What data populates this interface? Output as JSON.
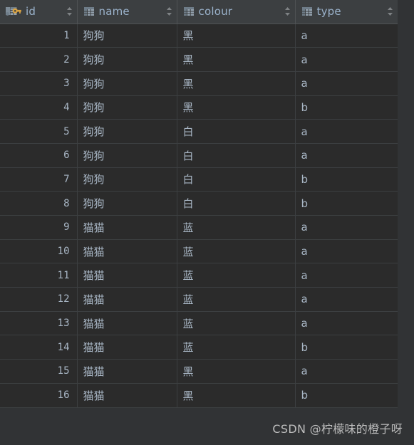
{
  "colors": {
    "header_bg": "#3c3f41",
    "row_bg": "#2b2b2b",
    "page_bg": "#313335",
    "grid_line": "#3c3f41",
    "header_text": "#9bb3cc",
    "cell_text": "#a9b7c6",
    "key_icon": "#d9a343",
    "table_icon": "#93a1ad",
    "watermark_text": "#c8c8c8"
  },
  "table": {
    "columns": [
      {
        "label": "id",
        "icon": "primary-key-icon",
        "sort_icon": "sort-updown-icon",
        "align": "right"
      },
      {
        "label": "name",
        "icon": "table-column-icon",
        "sort_icon": "sort-updown-icon",
        "align": "left"
      },
      {
        "label": "colour",
        "icon": "table-column-icon",
        "sort_icon": "sort-updown-icon",
        "align": "left"
      },
      {
        "label": "type",
        "icon": "table-column-icon",
        "sort_icon": "sort-updown-icon",
        "align": "left"
      }
    ],
    "rows": [
      {
        "id": "1",
        "name": "狗狗",
        "colour": "黑",
        "type": "a"
      },
      {
        "id": "2",
        "name": "狗狗",
        "colour": "黑",
        "type": "a"
      },
      {
        "id": "3",
        "name": "狗狗",
        "colour": "黑",
        "type": "a"
      },
      {
        "id": "4",
        "name": "狗狗",
        "colour": "黑",
        "type": "b"
      },
      {
        "id": "5",
        "name": "狗狗",
        "colour": "白",
        "type": "a"
      },
      {
        "id": "6",
        "name": "狗狗",
        "colour": "白",
        "type": "a"
      },
      {
        "id": "7",
        "name": "狗狗",
        "colour": "白",
        "type": "b"
      },
      {
        "id": "8",
        "name": "狗狗",
        "colour": "白",
        "type": "b"
      },
      {
        "id": "9",
        "name": "猫猫",
        "colour": "蓝",
        "type": "a"
      },
      {
        "id": "10",
        "name": "猫猫",
        "colour": "蓝",
        "type": "a"
      },
      {
        "id": "11",
        "name": "猫猫",
        "colour": "蓝",
        "type": "a"
      },
      {
        "id": "12",
        "name": "猫猫",
        "colour": "蓝",
        "type": "a"
      },
      {
        "id": "13",
        "name": "猫猫",
        "colour": "蓝",
        "type": "a"
      },
      {
        "id": "14",
        "name": "猫猫",
        "colour": "蓝",
        "type": "b"
      },
      {
        "id": "15",
        "name": "猫猫",
        "colour": "黑",
        "type": "a"
      },
      {
        "id": "16",
        "name": "猫猫",
        "colour": "黑",
        "type": "b"
      }
    ]
  },
  "watermark": {
    "text": "CSDN @柠檬味的橙子呀"
  }
}
